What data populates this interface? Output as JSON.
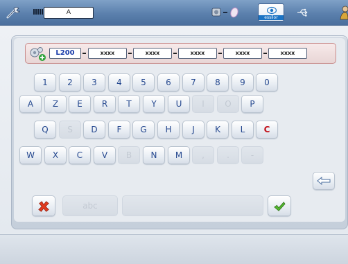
{
  "topbar": {
    "field_value": "A",
    "logo_text": "essilor",
    "icons": [
      "tool-icon",
      "signal-icon",
      "device-icon",
      "essilor-logo",
      "usb-icon",
      "user-icon"
    ]
  },
  "code": {
    "fields": [
      "L200",
      "xxxx",
      "xxxx",
      "xxxx",
      "xxxx",
      "xxxx"
    ],
    "icon": "settings-add-icon"
  },
  "keyboard": {
    "row1": [
      "1",
      "2",
      "3",
      "4",
      "5",
      "6",
      "7",
      "8",
      "9",
      "0"
    ],
    "row2": [
      "A",
      "Z",
      "E",
      "R",
      "T",
      "Y",
      "U",
      "I",
      "O",
      "P"
    ],
    "row2_disabled": [
      false,
      false,
      false,
      false,
      false,
      false,
      false,
      true,
      true,
      false
    ],
    "row3": [
      "Q",
      "S",
      "D",
      "F",
      "G",
      "H",
      "J",
      "K",
      "L",
      "C"
    ],
    "row3_disabled": [
      false,
      true,
      false,
      false,
      false,
      false,
      false,
      false,
      false,
      false
    ],
    "row4": [
      "W",
      "X",
      "C",
      "V",
      "B",
      "N",
      "M",
      ",",
      ".",
      "-"
    ],
    "row4_disabled": [
      false,
      false,
      false,
      false,
      true,
      false,
      false,
      true,
      true,
      true
    ],
    "mode_key": "abc",
    "backspace_icon": "backspace-arrow-icon",
    "cancel_icon": "red-x-icon",
    "confirm_icon": "green-check-icon"
  },
  "colors": {
    "topbar": "#5b80ad",
    "key_text": "#25488f",
    "clear_key_text": "#c2101a",
    "codebar_border": "#c88b8b"
  }
}
